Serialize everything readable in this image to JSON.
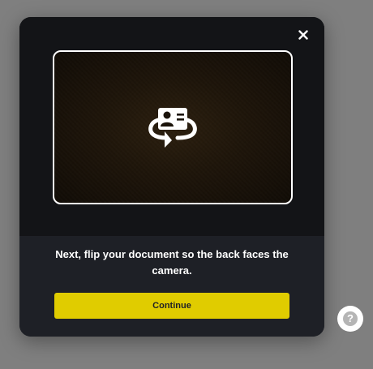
{
  "dialog": {
    "close_icon": "close-icon",
    "illustration_icon": "document-flip-icon",
    "message": "Next, flip your document so the back faces the camera.",
    "continue_label": "Continue"
  },
  "help": {
    "icon": "question-mark-icon",
    "glyph": "?"
  },
  "colors": {
    "backdrop": "#808080",
    "modal_top": "#131417",
    "modal_bottom": "#1e2026",
    "accent": "#e0cc00",
    "frame": "#ffffff"
  }
}
